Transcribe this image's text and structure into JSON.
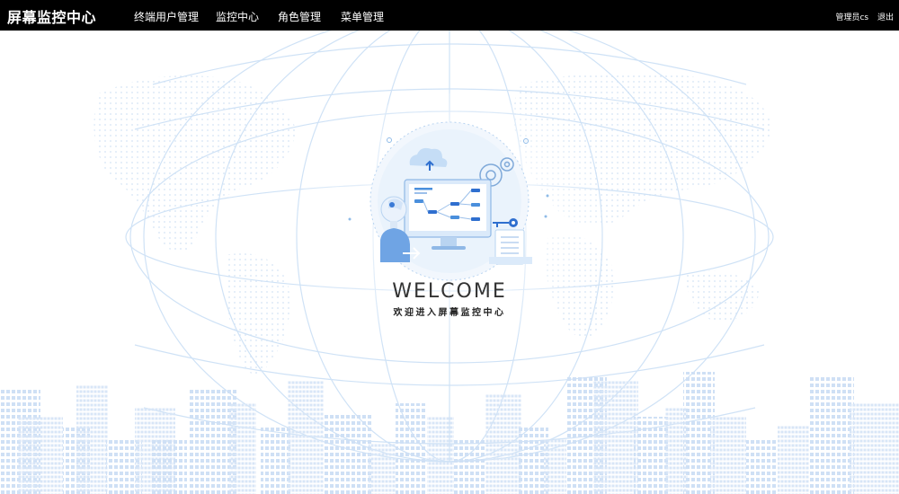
{
  "app": {
    "title": "屏幕监控中心"
  },
  "nav": {
    "items": [
      {
        "label": "终端用户管理"
      },
      {
        "label": "监控中心"
      },
      {
        "label": "角色管理"
      },
      {
        "label": "菜单管理"
      }
    ]
  },
  "user": {
    "name": "管理员cs",
    "logout_label": "退出"
  },
  "welcome": {
    "title": "WELCOME",
    "subtitle": "欢迎进入屏幕监控中心"
  },
  "colors": {
    "topbar": "#000000",
    "accent": "#4a8fdc",
    "light_blue": "#dbeafa",
    "grid_line": "#cfe2f6"
  },
  "illustration": {
    "icons": [
      "cloud-upload-icon",
      "gear-icon",
      "monitor-icon",
      "person-icon",
      "document-icon",
      "key-icon"
    ]
  }
}
